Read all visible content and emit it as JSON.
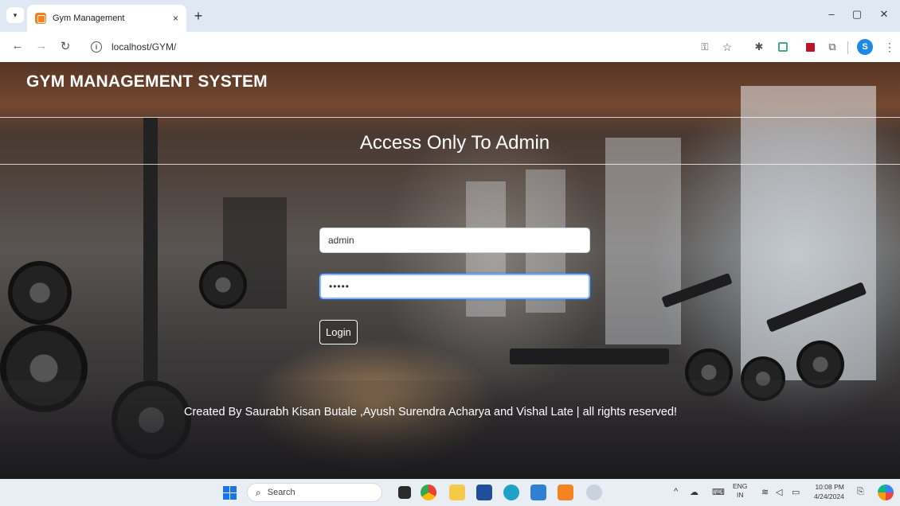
{
  "browser": {
    "tab_title": "Gym Management",
    "tab_close": "×",
    "new_tab": "+",
    "url": "localhost/GYM/",
    "window_controls": {
      "minimize": "–",
      "restore": "▢",
      "close": "✕"
    }
  },
  "page": {
    "brand": "GYM MANAGEMENT SYSTEM",
    "heading": "Access Only To Admin",
    "username_value": "admin",
    "password_value": "•••••",
    "login_label": "Login",
    "footer": "Created By Saurabh Kisan Butale ,Ayush Surendra Acharya and Vishal Late | all rights reserved!"
  },
  "taskbar": {
    "search_placeholder": "Search",
    "lang_line1": "ENG",
    "lang_line2": "IN",
    "time": "10:08 PM",
    "date": "4/24/2024"
  }
}
